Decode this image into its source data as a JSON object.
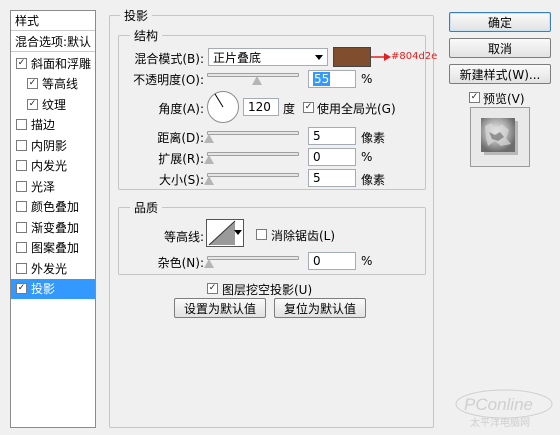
{
  "styles": {
    "header": "样式",
    "blend_options": "混合选项:默认",
    "items": [
      {
        "label": "斜面和浮雕",
        "checked": true,
        "indent": false,
        "selected": false
      },
      {
        "label": "等高线",
        "checked": true,
        "indent": true,
        "selected": false
      },
      {
        "label": "纹理",
        "checked": true,
        "indent": true,
        "selected": false
      },
      {
        "label": "描边",
        "checked": false,
        "indent": false,
        "selected": false
      },
      {
        "label": "内阴影",
        "checked": false,
        "indent": false,
        "selected": false
      },
      {
        "label": "内发光",
        "checked": false,
        "indent": false,
        "selected": false
      },
      {
        "label": "光泽",
        "checked": false,
        "indent": false,
        "selected": false
      },
      {
        "label": "颜色叠加",
        "checked": false,
        "indent": false,
        "selected": false
      },
      {
        "label": "渐变叠加",
        "checked": false,
        "indent": false,
        "selected": false
      },
      {
        "label": "图案叠加",
        "checked": false,
        "indent": false,
        "selected": false
      },
      {
        "label": "外发光",
        "checked": false,
        "indent": false,
        "selected": false
      },
      {
        "label": "投影",
        "checked": true,
        "indent": false,
        "selected": true
      }
    ]
  },
  "drop_shadow": {
    "title": "投影",
    "structure": {
      "title": "结构",
      "blend_mode_label": "混合模式(B):",
      "blend_mode_value": "正片叠底",
      "color": "#804d2e",
      "color_annotation": "#804d2e",
      "opacity_label": "不透明度(O):",
      "opacity_value": "55",
      "opacity_unit": "%",
      "angle_label": "角度(A):",
      "angle_value": "120",
      "angle_unit": "度",
      "global_light_label": "使用全局光(G)",
      "global_light_checked": true,
      "distance_label": "距离(D):",
      "distance_value": "5",
      "distance_unit": "像素",
      "spread_label": "扩展(R):",
      "spread_value": "0",
      "spread_unit": "%",
      "size_label": "大小(S):",
      "size_value": "5",
      "size_unit": "像素"
    },
    "quality": {
      "title": "品质",
      "contour_label": "等高线:",
      "antialias_label": "消除锯齿(L)",
      "antialias_checked": false,
      "noise_label": "杂色(N):",
      "noise_value": "0",
      "noise_unit": "%"
    },
    "knockout_label": "图层挖空投影(U)",
    "knockout_checked": true,
    "make_default_label": "设置为默认值",
    "reset_default_label": "复位为默认值"
  },
  "buttons": {
    "ok": "确定",
    "cancel": "取消",
    "new_style": "新建样式(W)...",
    "preview_label": "预览(V)",
    "preview_checked": true
  },
  "watermark": {
    "brand": "PConline",
    "tagline": "太平洋电脑网"
  },
  "slider_levels": {
    "opacity": 0.55,
    "distance": 0.0,
    "spread": 0.0,
    "size": 0.0,
    "noise": 0.0
  }
}
